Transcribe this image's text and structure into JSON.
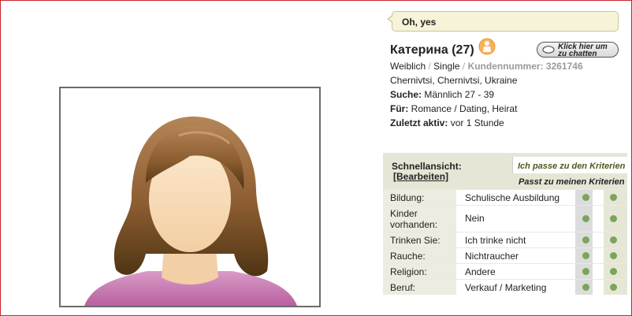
{
  "status": {
    "text": "Oh, yes"
  },
  "profile": {
    "name": "Катерина (27)",
    "online_icon": "person-online-icon",
    "chat_button_label": "Klick hier um zu chatten",
    "gender": "Weiblich",
    "separator": "/",
    "relationship": "Single",
    "customer_number": "Kundennummer: 3261746",
    "location": "Chernivtsi, Chernivtsi, Ukraine",
    "search_label": "Suche:",
    "search_value": "Männlich 27 - 39",
    "for_label": "Für:",
    "for_value": "Romance / Dating, Heirat",
    "last_active_label": "Zuletzt aktiv:",
    "last_active_value": "vor 1 Stunde"
  },
  "quickview": {
    "title": "Schnellansicht:",
    "edit": "[Bearbeiten]",
    "criteria_mine": "Ich passe zu den Kriterien",
    "criteria_theirs": "Passt zu meinen Kriterien",
    "rows": [
      {
        "label": "Bildung:",
        "value": "Schulische Ausbildung"
      },
      {
        "label": "Kinder vorhanden:",
        "value": "Nein"
      },
      {
        "label": "Trinken Sie:",
        "value": "Ich trinke nicht"
      },
      {
        "label": "Rauche:",
        "value": "Nichtraucher"
      },
      {
        "label": "Religion:",
        "value": "Andere"
      },
      {
        "label": "Beruf:",
        "value": "Verkauf / Marketing"
      }
    ]
  },
  "colors": {
    "frame_border": "#c8262a",
    "match_dot": "#7aa55a",
    "hair": "#9a6a3a",
    "shirt": "#c97ab4"
  }
}
